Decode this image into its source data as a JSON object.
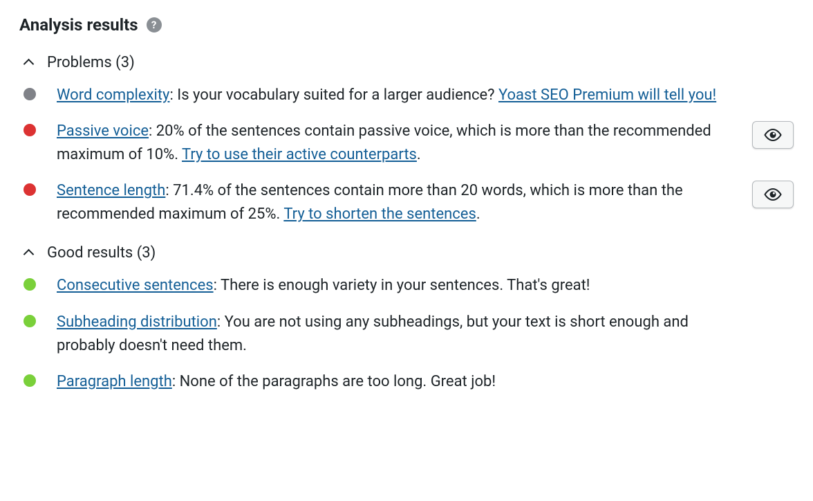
{
  "header": {
    "title": "Analysis results"
  },
  "sections": {
    "problems": {
      "label": "Problems",
      "count": 3
    },
    "good": {
      "label": "Good results",
      "count": 3
    }
  },
  "problems": [
    {
      "color": "gray",
      "link1": "Word complexity",
      "text1": ": Is your vocabulary suited for a larger audience? ",
      "link2": "Yoast SEO Premium will tell you!",
      "text2": "",
      "eye": false
    },
    {
      "color": "red",
      "link1": "Passive voice",
      "text1": ": 20% of the sentences contain passive voice, which is more than the recommended maximum of 10%. ",
      "link2": "Try to use their active counterparts",
      "text2": ".",
      "eye": true
    },
    {
      "color": "red",
      "link1": "Sentence length",
      "text1": ": 71.4% of the sentences contain more than 20 words, which is more than the recommended maximum of 25%. ",
      "link2": "Try to shorten the sentences",
      "text2": ".",
      "eye": true
    }
  ],
  "good": [
    {
      "color": "green",
      "link1": "Consecutive sentences",
      "text1": ": There is enough variety in your sentences. That's great!",
      "link2": "",
      "text2": "",
      "eye": false
    },
    {
      "color": "green",
      "link1": "Subheading distribution",
      "text1": ": You are not using any subheadings, but your text is short enough and probably doesn't need them.",
      "link2": "",
      "text2": "",
      "eye": false
    },
    {
      "color": "green",
      "link1": "Paragraph length",
      "text1": ": None of the paragraphs are too long. Great job!",
      "link2": "",
      "text2": "",
      "eye": false
    }
  ]
}
